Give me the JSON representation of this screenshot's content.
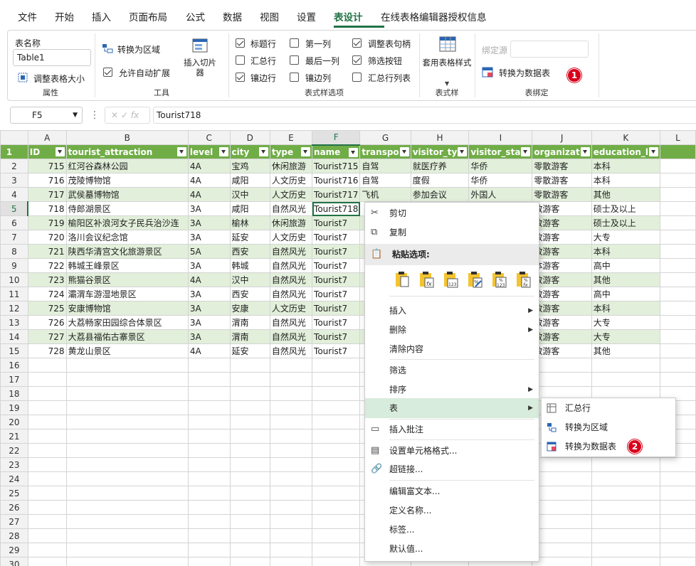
{
  "menu": [
    "文件",
    "开始",
    "插入",
    "页面布局",
    "公式",
    "数据",
    "视图",
    "设置",
    "表设计",
    "在线表格编辑器授权信息"
  ],
  "active_menu": "表设计",
  "ribbon": {
    "props": {
      "table_name_label": "表名称",
      "table_name_value": "Table1",
      "resize_label": "调整表格大小",
      "group": "属性"
    },
    "tools": {
      "convert_range": "转换为区域",
      "auto_expand": "允许自动扩展",
      "insert_slicer": "插入切片器",
      "group": "工具"
    },
    "style_opts": {
      "header_row": "标题行",
      "first_col": "第一列",
      "resize_handle": "调整表句柄",
      "total_row": "汇总行",
      "last_col": "最后一列",
      "filter_btn": "筛选按钮",
      "banded_rows": "镶边行",
      "banded_cols": "镶边列",
      "total_row_list": "汇总行列表",
      "group": "表式样选项"
    },
    "styles": {
      "apply_style": "套用表格样式",
      "group": "表式样"
    },
    "binding": {
      "bind_source": "绑定源",
      "convert_datatable": "转换为数据表",
      "group": "表绑定"
    },
    "badge1": "1"
  },
  "formula_bar": {
    "name_box": "F5",
    "fx": "fx",
    "content": "Tourist718"
  },
  "columns": [
    "A",
    "B",
    "C",
    "D",
    "E",
    "F",
    "G",
    "H",
    "I",
    "J",
    "K",
    "L"
  ],
  "header": [
    "ID",
    "tourist_attraction",
    "level",
    "city",
    "type",
    "name",
    "transpo",
    "visitor_ty",
    "visitor_sta",
    "organizat",
    "education_l"
  ],
  "rows": [
    [
      "715",
      "红河谷森林公园",
      "4A",
      "宝鸡",
      "休闲旅游",
      "Tourist715",
      "自驾",
      "就医疗养",
      "华侨",
      "零散游客",
      "本科"
    ],
    [
      "716",
      "茂陵博物馆",
      "4A",
      "咸阳",
      "人文历史",
      "Tourist716",
      "自驾",
      "度假",
      "华侨",
      "零散游客",
      "本科"
    ],
    [
      "717",
      "武侯墓博物馆",
      "4A",
      "汉中",
      "人文历史",
      "Tourist717",
      "飞机",
      "参加会议",
      "外国人",
      "零散游客",
      "其他"
    ],
    [
      "718",
      "侍郎湖景区",
      "3A",
      "咸阳",
      "自然风光",
      "Tourist718",
      "",
      "",
      "",
      "散游客",
      "硕士及以上"
    ],
    [
      "719",
      "榆阳区补浪河女子民兵治沙连",
      "3A",
      "榆林",
      "休闲旅游",
      "Tourist7",
      "",
      "",
      "",
      "散游客",
      "硕士及以上"
    ],
    [
      "720",
      "洛川会议纪念馆",
      "3A",
      "延安",
      "人文历史",
      "Tourist7",
      "",
      "",
      "",
      "散游客",
      "大专"
    ],
    [
      "721",
      "陕西华清宫文化旅游景区",
      "5A",
      "西安",
      "自然风光",
      "Tourist7",
      "",
      "",
      "",
      "散游客",
      "本科"
    ],
    [
      "722",
      "韩城王峰景区",
      "3A",
      "韩城",
      "自然风光",
      "Tourist7",
      "",
      "",
      "",
      "体游客",
      "高中"
    ],
    [
      "723",
      "熊猫谷景区",
      "4A",
      "汉中",
      "自然风光",
      "Tourist7",
      "",
      "",
      "",
      "散游客",
      "其他"
    ],
    [
      "724",
      "灞渭车游湿地景区",
      "3A",
      "西安",
      "自然风光",
      "Tourist7",
      "",
      "",
      "",
      "散游客",
      "高中"
    ],
    [
      "725",
      "安康博物馆",
      "3A",
      "安康",
      "人文历史",
      "Tourist7",
      "",
      "",
      "",
      "散游客",
      "本科"
    ],
    [
      "726",
      "大荔畅家田园综合体景区",
      "3A",
      "渭南",
      "自然风光",
      "Tourist7",
      "",
      "",
      "",
      "散游客",
      "大专"
    ],
    [
      "727",
      "大荔县福佑古寨景区",
      "3A",
      "渭南",
      "自然风光",
      "Tourist7",
      "",
      "",
      "",
      "散游客",
      "大专"
    ],
    [
      "728",
      "黄龙山景区",
      "4A",
      "延安",
      "自然风光",
      "Tourist7",
      "",
      "",
      "",
      "散游客",
      "其他"
    ]
  ],
  "row_numbers": [
    "1",
    "2",
    "3",
    "4",
    "5",
    "6",
    "7",
    "8",
    "9",
    "10",
    "11",
    "12",
    "13",
    "14",
    "15",
    "16",
    "17",
    "18",
    "19",
    "20",
    "21",
    "22",
    "23",
    "24",
    "25",
    "26",
    "27",
    "28",
    "29",
    "30"
  ],
  "context_menu": {
    "cut": "剪切",
    "copy": "复制",
    "paste_options": "粘贴选项:",
    "insert": "插入",
    "delete": "删除",
    "clear": "清除内容",
    "filter": "筛选",
    "sort": "排序",
    "table": "表",
    "insert_comment": "插入批注",
    "format_cells": "设置单元格格式...",
    "hyperlink": "超链接...",
    "edit_rich": "编辑富文本...",
    "define_name": "定义名称...",
    "tag": "标签...",
    "default_value": "默认值..."
  },
  "submenu": {
    "total_row": "汇总行",
    "convert_range": "转换为区域",
    "convert_datatable": "转换为数据表",
    "badge2": "2"
  },
  "colors": {
    "accent": "#217346",
    "table_header": "#70ad47",
    "band": "#e2efda",
    "badge": "#d9001b"
  }
}
